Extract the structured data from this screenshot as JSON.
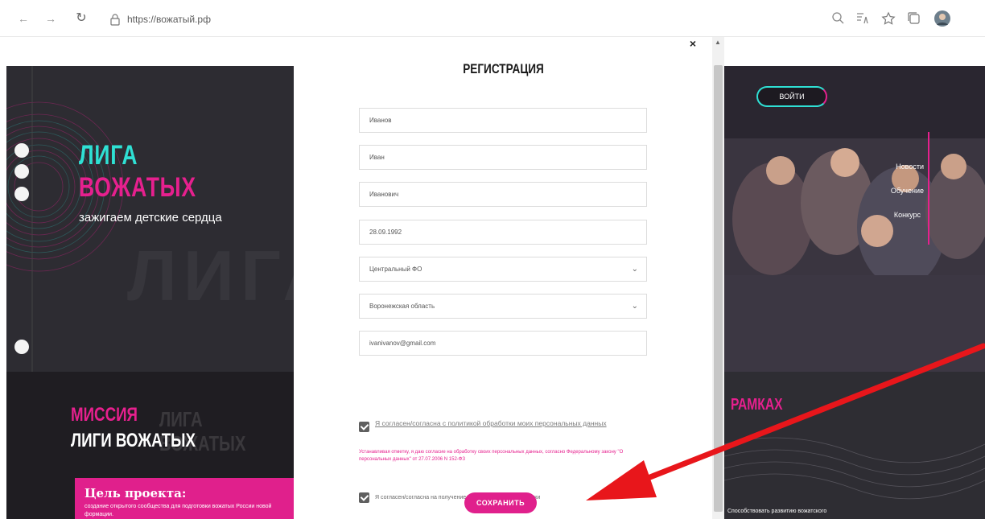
{
  "browser": {
    "url": "https://вожатый.рф",
    "icons": [
      "back-icon",
      "forward-icon",
      "refresh-icon",
      "lock-icon",
      "zoom-icon",
      "read-aloud-icon",
      "favorites-icon",
      "collections-icon",
      "profile-avatar"
    ]
  },
  "site_left": {
    "logo_line1": "ЛИГА",
    "logo_line2": "ВОЖАТЫХ",
    "tagline": "зажигаем детские сердца",
    "ghost_text": "ЛИГА",
    "mission_line1": "МИССИЯ",
    "mission_line2": "ЛИГИ ВОЖАТЫХ",
    "mission_ghost_line1": "ЛИГА",
    "mission_ghost_line2": "ВОЖАТЫХ",
    "goal_title": "Цель проекта:",
    "goal_text": "создание открытого сообщества для подготовки вожатых России новой формации."
  },
  "site_right": {
    "login_label": "ВОЙТИ",
    "nav": [
      "Новости",
      "Обучение",
      "Конкурс"
    ],
    "frame_text": "РАМКАХ",
    "bottom_text": "Способствовать развитию вожатского"
  },
  "modal": {
    "title": "РЕГИСТРАЦИЯ",
    "close": "×",
    "fields": {
      "last_name": "Иванов",
      "first_name": "Иван",
      "patronymic": "Иванович",
      "birth_date": "28.09.1992",
      "district": "Центральный ФО",
      "region": "Воронежская область",
      "email": "ivanivanov@gmail.com"
    },
    "consent_label": "Я согласен/согласна с политикой обработки моих персональных данных",
    "consent_note": "Устанавливая отметку, я даю согласие на обработку своих персональных данных, согласно Федеральному закону \"О персональных данных\" от 27.07.2006 N 152-ФЗ",
    "newsletter_label": "Я согласен/согласна на получение информационной рассылки",
    "save_label": "СОХРАНИТЬ"
  },
  "colors": {
    "brand_pink": "#e0208c",
    "brand_teal": "#2fe0d4",
    "dark_bg": "#2d2c32",
    "annotation_arrow": "#e8161b"
  }
}
